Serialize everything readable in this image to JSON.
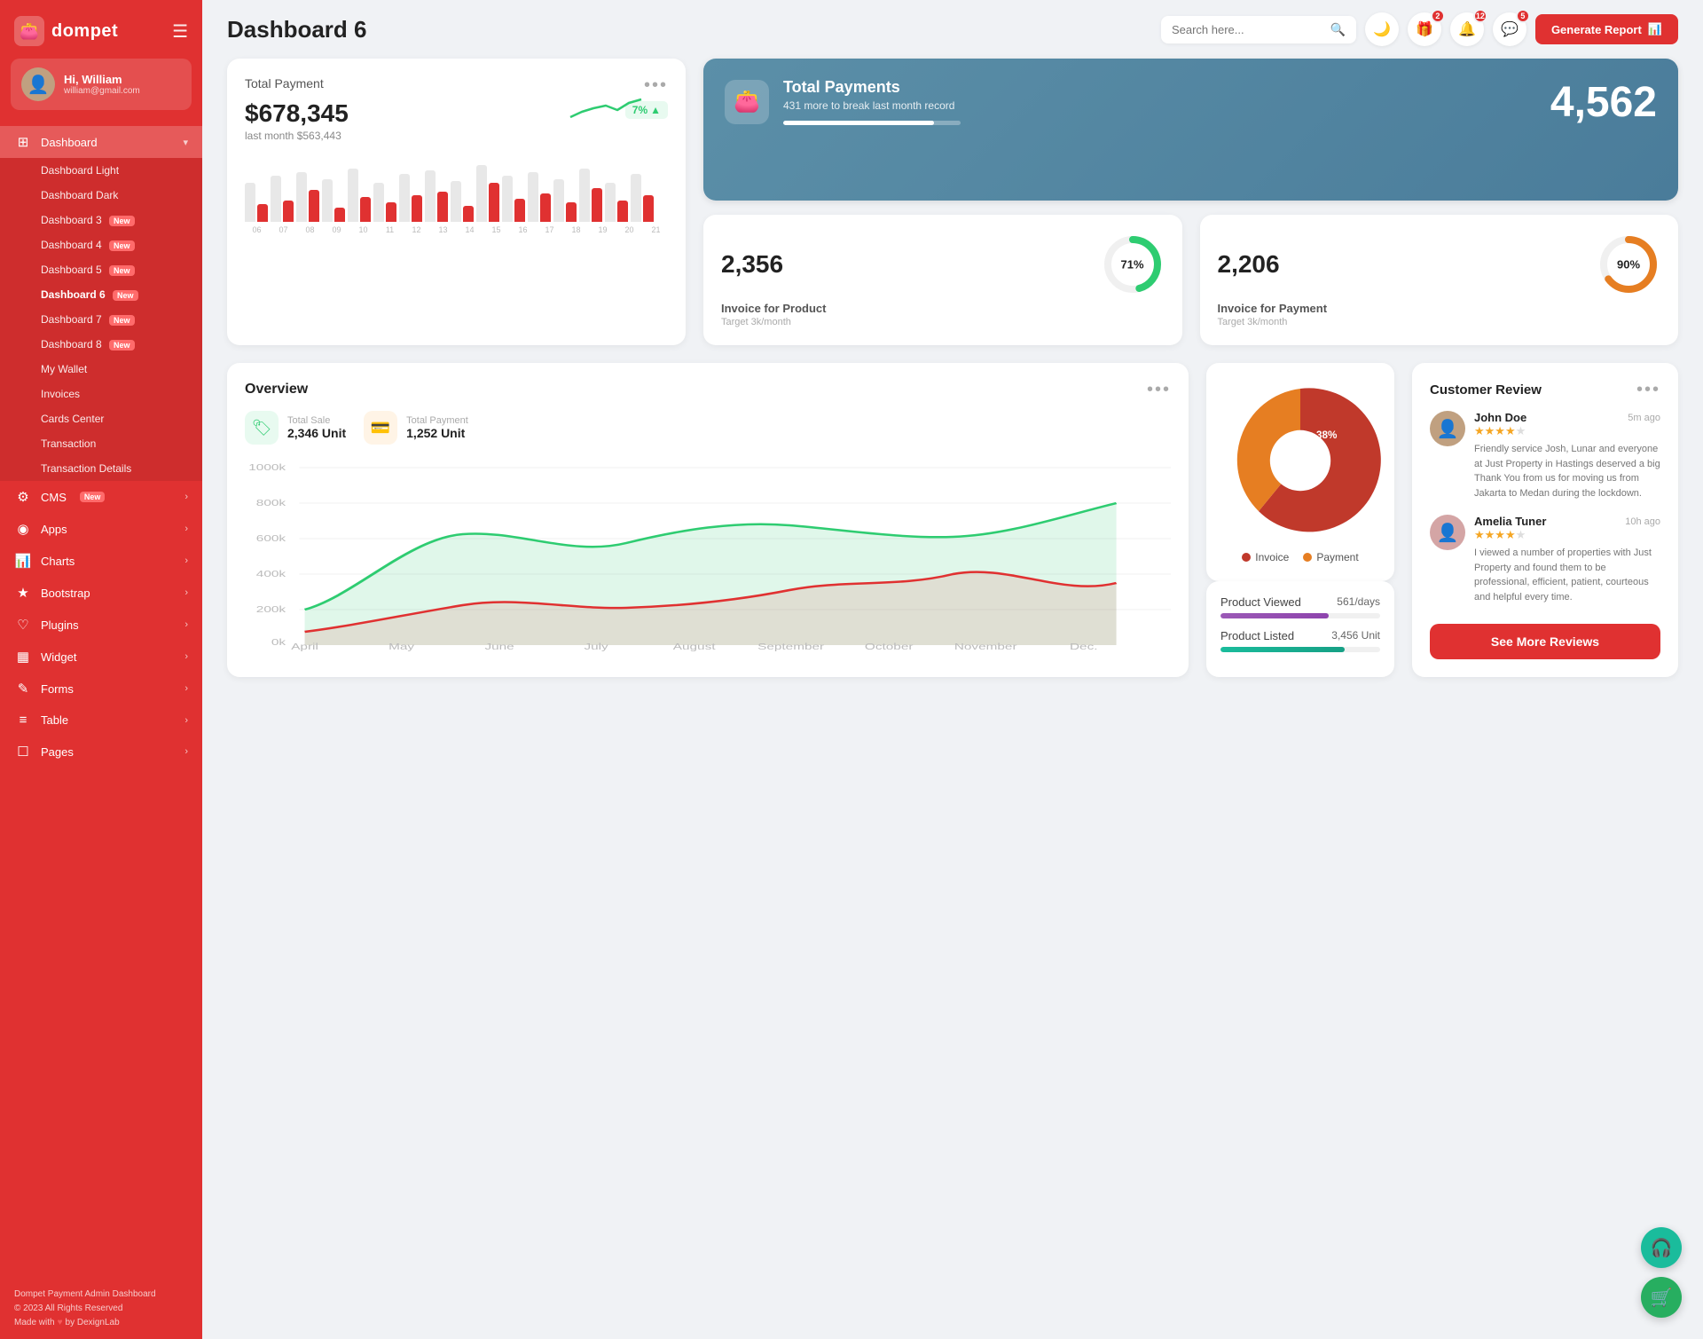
{
  "app": {
    "name": "dompet",
    "title": "Dashboard 6"
  },
  "header": {
    "search_placeholder": "Search here...",
    "badge_gift": "2",
    "badge_bell": "12",
    "badge_msg": "5",
    "generate_btn": "Generate Report"
  },
  "user": {
    "greeting": "Hi, William",
    "email": "william@gmail.com"
  },
  "sidebar": {
    "menu": [
      {
        "label": "Dashboard",
        "icon": "⊞",
        "has_arrow": true,
        "active": true
      },
      {
        "label": "CMS",
        "icon": "⚙",
        "has_arrow": true,
        "badge": "New"
      },
      {
        "label": "Apps",
        "icon": "◉",
        "has_arrow": true
      },
      {
        "label": "Charts",
        "icon": "📊",
        "has_arrow": true
      },
      {
        "label": "Bootstrap",
        "icon": "★",
        "has_arrow": true
      },
      {
        "label": "Plugins",
        "icon": "♡",
        "has_arrow": true
      },
      {
        "label": "Widget",
        "icon": "▦",
        "has_arrow": true
      },
      {
        "label": "Forms",
        "icon": "✎",
        "has_arrow": true
      },
      {
        "label": "Table",
        "icon": "≡",
        "has_arrow": true
      },
      {
        "label": "Pages",
        "icon": "☐",
        "has_arrow": true
      }
    ],
    "sub_items": [
      {
        "label": "Dashboard Light"
      },
      {
        "label": "Dashboard Dark"
      },
      {
        "label": "Dashboard 3",
        "badge": "New"
      },
      {
        "label": "Dashboard 4",
        "badge": "New"
      },
      {
        "label": "Dashboard 5",
        "badge": "New"
      },
      {
        "label": "Dashboard 6",
        "badge": "New",
        "active": true
      },
      {
        "label": "Dashboard 7",
        "badge": "New"
      },
      {
        "label": "Dashboard 8",
        "badge": "New"
      },
      {
        "label": "My Wallet"
      },
      {
        "label": "Invoices"
      },
      {
        "label": "Cards Center"
      },
      {
        "label": "Transaction"
      },
      {
        "label": "Transaction Details"
      }
    ],
    "footer": {
      "line1": "Dompet Payment Admin Dashboard",
      "line2": "© 2023 All Rights Reserved",
      "line3": "Made with ♥ by DexignLab"
    }
  },
  "total_payment": {
    "label": "Total Payment",
    "amount": "$678,345",
    "last_month": "last month $563,443",
    "trend": "7%",
    "bars": [
      {
        "gray": 55,
        "red": 25
      },
      {
        "gray": 65,
        "red": 30
      },
      {
        "gray": 70,
        "red": 45
      },
      {
        "gray": 60,
        "red": 20
      },
      {
        "gray": 75,
        "red": 35
      },
      {
        "gray": 55,
        "red": 28
      },
      {
        "gray": 68,
        "red": 38
      },
      {
        "gray": 72,
        "red": 42
      },
      {
        "gray": 58,
        "red": 22
      },
      {
        "gray": 80,
        "red": 55
      },
      {
        "gray": 65,
        "red": 32
      },
      {
        "gray": 70,
        "red": 40
      },
      {
        "gray": 60,
        "red": 28
      },
      {
        "gray": 75,
        "red": 48
      },
      {
        "gray": 55,
        "red": 30
      },
      {
        "gray": 68,
        "red": 38
      }
    ],
    "x_labels": [
      "06",
      "07",
      "08",
      "09",
      "10",
      "11",
      "12",
      "13",
      "14",
      "15",
      "16",
      "17",
      "18",
      "19",
      "20",
      "21"
    ]
  },
  "total_payments_card": {
    "title": "Total Payments",
    "sub": "431 more to break last month record",
    "value": "4,562",
    "progress_pct": 85
  },
  "invoice_product": {
    "number": "2,356",
    "label": "Invoice for Product",
    "target": "Target 3k/month",
    "pct": 71,
    "color": "#2ecc71"
  },
  "invoice_payment": {
    "number": "2,206",
    "label": "Invoice for Payment",
    "target": "Target 3k/month",
    "pct": 90,
    "color": "#e67e22"
  },
  "overview": {
    "title": "Overview",
    "total_sale_label": "Total Sale",
    "total_sale_value": "2,346 Unit",
    "total_payment_label": "Total Payment",
    "total_payment_value": "1,252 Unit",
    "x_labels": [
      "April",
      "May",
      "June",
      "July",
      "August",
      "September",
      "October",
      "November",
      "Dec."
    ],
    "y_labels": [
      "0k",
      "200k",
      "400k",
      "600k",
      "800k",
      "1000k"
    ]
  },
  "pie_chart": {
    "invoice_pct": 62,
    "payment_pct": 38,
    "invoice_label": "Invoice",
    "payment_label": "Payment",
    "invoice_color": "#c0392b",
    "payment_color": "#e67e22"
  },
  "product_stats": {
    "viewed_label": "Product Viewed",
    "viewed_value": "561/days",
    "viewed_pct": 68,
    "listed_label": "Product Listed",
    "listed_value": "3,456 Unit",
    "listed_pct": 78
  },
  "reviews": {
    "title": "Customer Review",
    "see_more": "See More Reviews",
    "items": [
      {
        "name": "John Doe",
        "time": "5m ago",
        "stars": 4,
        "text": "Friendly service Josh, Lunar and everyone at Just Property in Hastings deserved a big Thank You from us for moving us from Jakarta to Medan during the lockdown."
      },
      {
        "name": "Amelia Tuner",
        "time": "10h ago",
        "stars": 4,
        "text": "I viewed a number of properties with Just Property and found them to be professional, efficient, patient, courteous and helpful every time."
      }
    ]
  }
}
